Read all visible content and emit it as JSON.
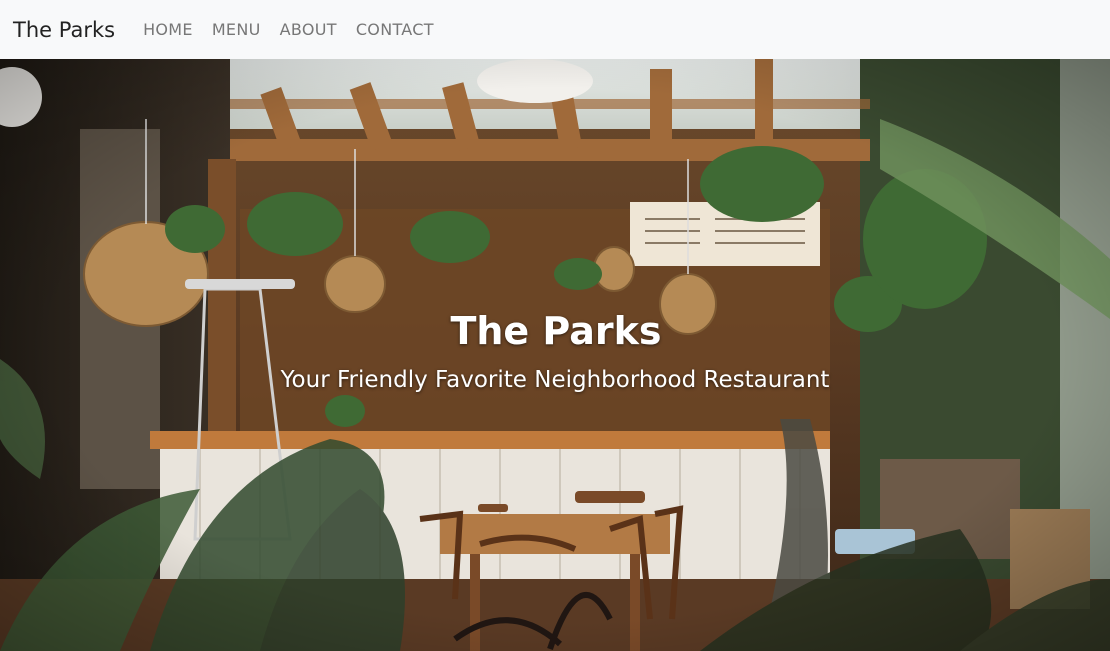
{
  "navbar": {
    "brand": "The Parks",
    "links": [
      {
        "label": "HOME"
      },
      {
        "label": "MENU"
      },
      {
        "label": "ABOUT"
      },
      {
        "label": "CONTACT"
      }
    ]
  },
  "hero": {
    "title": "The Parks",
    "subtitle": "Your Friendly Favorite Neighborhood Restaurant",
    "image_description_icon": "restaurant-interior-photo"
  },
  "colors": {
    "navbar_bg": "#f8f9fa",
    "brand_text": "#222222",
    "nav_link_text": "#777777",
    "hero_text": "#ffffff"
  }
}
